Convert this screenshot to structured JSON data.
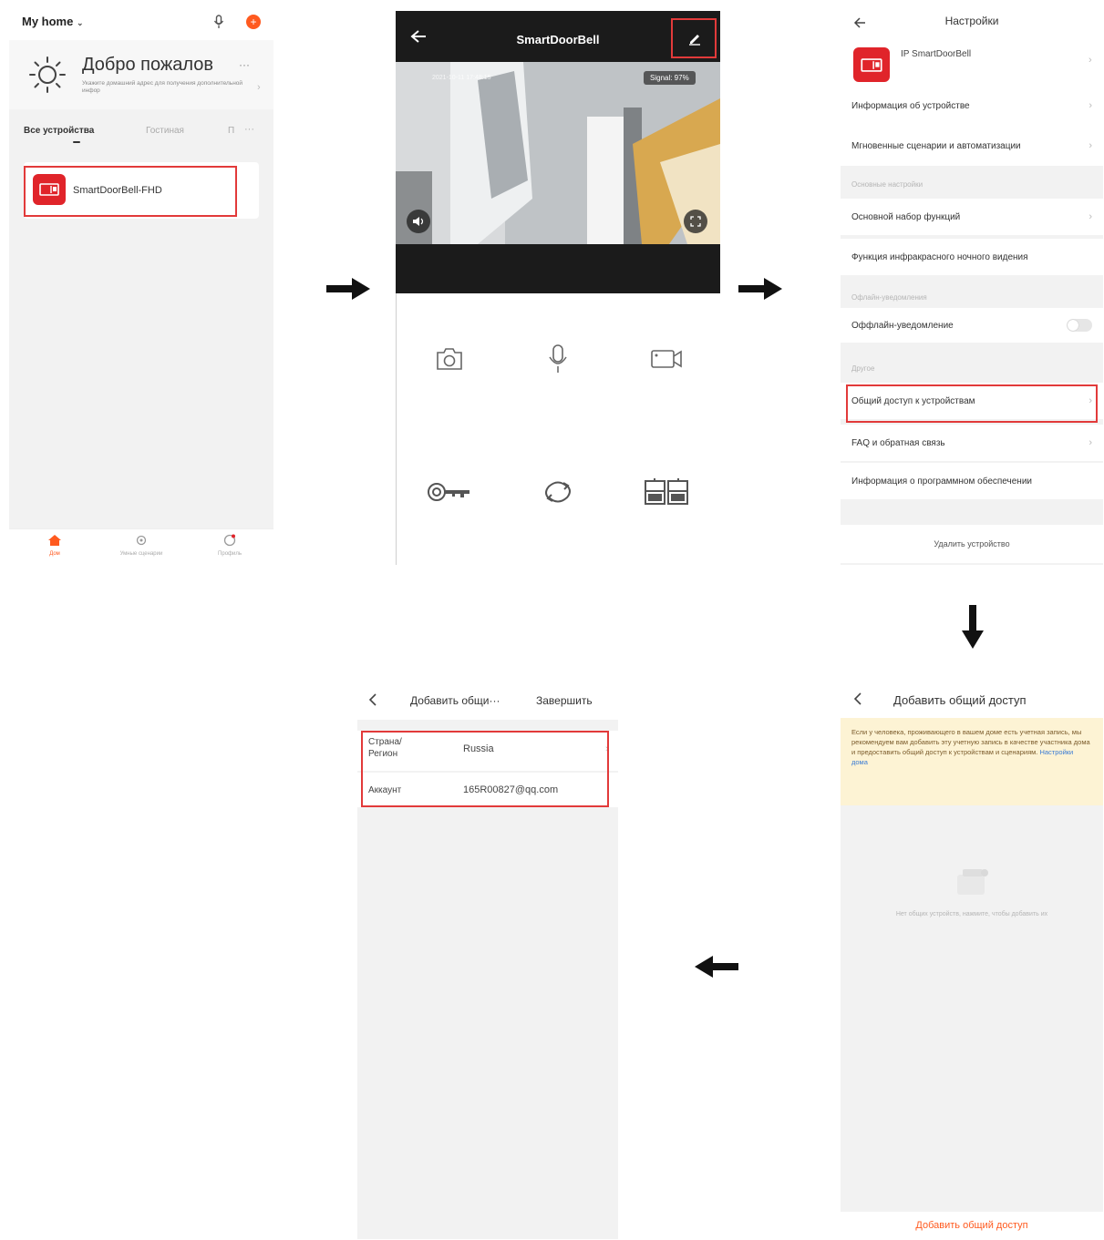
{
  "screen1": {
    "home_title": "My home",
    "welcome_title": "Добро пожалов",
    "welcome_subtitle": "Укажите домашний адрес для получения дополнительной инфор",
    "tabs": [
      "Все устройства",
      "Гостиная",
      "П"
    ],
    "device_name": "SmartDoorBell-FHD",
    "bottom_nav": [
      "Дом",
      "Умные сценарии",
      "Профиль"
    ]
  },
  "screen2": {
    "title": "SmartDoorBell",
    "signal": "Signal: 97%",
    "timestamp": "2021-10-11 17:48:15",
    "controls": [
      "camera-icon",
      "microphone-icon",
      "video-record-icon",
      "key-icon",
      "flip-icon",
      "gallery-icon"
    ]
  },
  "screen3": {
    "title": "Настройки",
    "device_label": "IP SmartDoorBell",
    "rows_top": [
      "Информация об устройстве",
      "Мгновенные сценарии и автоматизации"
    ],
    "section_basic": "Основные настройки",
    "rows_basic": [
      "Основной набор функций",
      "Функция инфракрасного ночного видения"
    ],
    "section_offline": "Офлайн-уведомления",
    "offline_row": "Оффлайн-уведомление",
    "section_other": "Другое",
    "rows_other": [
      "Общий доступ к устройствам",
      "FAQ и обратная связь",
      "Информация о программном обеспечении"
    ],
    "remove_device": "Удалить устройство"
  },
  "screen4": {
    "title": "Добавить общий доступ",
    "notice": "Если у человека, проживающего в вашем доме есть учетная запись, мы рекомендуем вам добавить эту учетную запись в качестве участника дома и предоставить общий доступ к устройствам и сценариям.",
    "notice_link": "Настройки дома",
    "empty_text": "Нет общих устройств, нажмите, чтобы добавить их",
    "add_button": "Добавить общий доступ"
  },
  "screen5": {
    "title": "Добавить общи···",
    "done": "Завершить",
    "country_label": "Страна/Регион",
    "country_value": "Russia",
    "account_label": "Аккаунт",
    "account_value": "165R00827@qq.com"
  },
  "colors": {
    "accent": "#ff5a1f",
    "red": "#e0242a",
    "highlight": "#e23a3a"
  }
}
